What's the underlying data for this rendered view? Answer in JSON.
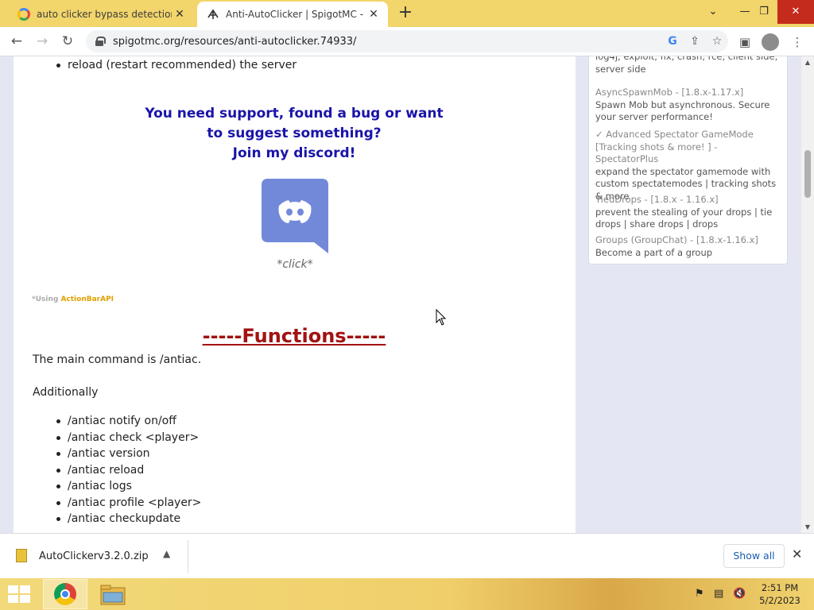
{
  "browser": {
    "tabs": [
      {
        "title": "auto clicker bypass detection git",
        "icon": "google-icon"
      },
      {
        "title": "Anti-AutoClicker | SpigotMC - Hi",
        "icon": "spigot-icon"
      }
    ],
    "url": "spigotmc.org/resources/anti-autoclicker.74933/"
  },
  "content": {
    "top_bullet": "reload (restart recommended) the server",
    "support_lines": [
      "You need support, found a bug or want",
      "to suggest something?",
      "Join my discord!"
    ],
    "click_label": "*click*",
    "using_prefix": "*Using ",
    "using_api": "ActionBarAPI",
    "functions_heading": "-----Functions-----",
    "main_command": "The main command is /antiac.",
    "additionally": "Additionally",
    "commands": [
      "/antiac notify on/off",
      "/antiac check <player>",
      "/antiac version",
      "/antiac reload",
      "/antiac logs",
      "/antiac profile <player>",
      "/antiac checkupdate"
    ]
  },
  "sidebar": {
    "items": [
      {
        "title": "",
        "desc": "log4j, exploit, fix, crash, rce, client side, server side"
      },
      {
        "title": "AsyncSpawnMob - [1.8.x-1.17.x]",
        "desc": "Spawn Mob but asynchronous. Secure your server performance!"
      },
      {
        "title": "✓ Advanced Spectator GameMode [Tracking shots & more! ] - SpectatorPlus",
        "desc": "expand the spectator gamemode with custom spectatemodes | tracking shots & more"
      },
      {
        "title": "TiedDrops - [1.8.x - 1.16.x]",
        "desc": "prevent the stealing of your drops | tie drops | share drops | drops"
      },
      {
        "title": "Groups (GroupChat) - [1.8.x-1.16.x]",
        "desc": "Become a part of a group"
      }
    ]
  },
  "download_bar": {
    "file_name": "AutoClickerv3.2.0.zip",
    "show_all": "Show all"
  },
  "taskbar": {
    "time": "2:51 PM",
    "date": "5/2/2023"
  },
  "colors": {
    "tab_strip": "#f2d56b",
    "support_text": "#1a14a8",
    "functions_heading": "#a31212",
    "discord": "#7289da",
    "actionbar_api": "#e0a000"
  }
}
